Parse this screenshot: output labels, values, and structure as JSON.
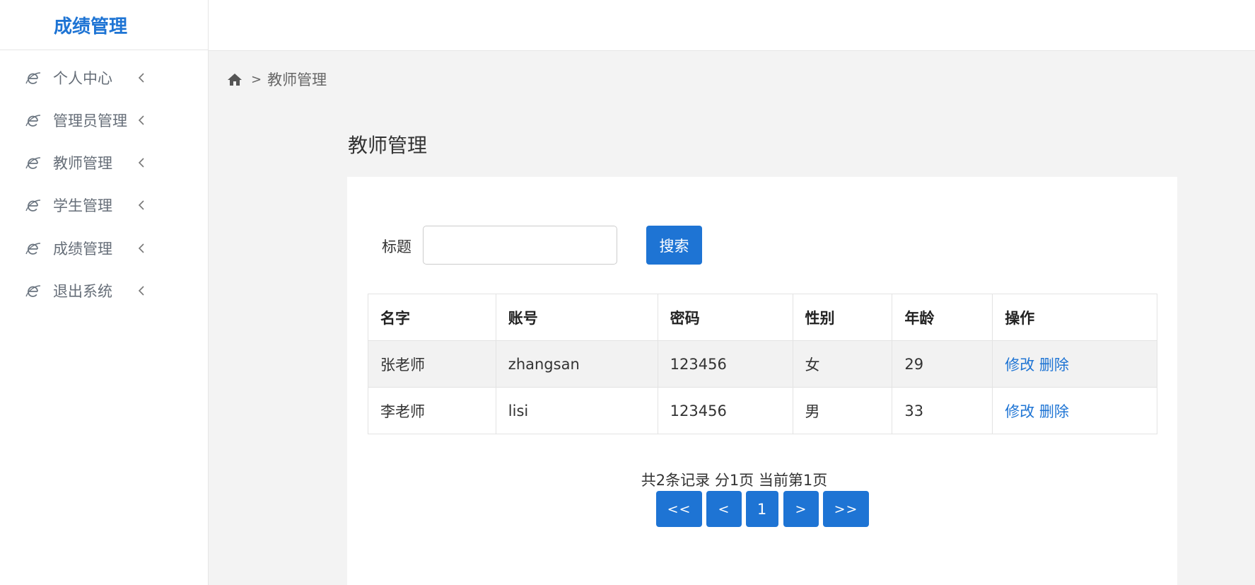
{
  "sidebar": {
    "brand": "成绩管理",
    "items": [
      {
        "label": "个人中心"
      },
      {
        "label": "管理员管理"
      },
      {
        "label": "教师管理"
      },
      {
        "label": "学生管理"
      },
      {
        "label": "成绩管理"
      },
      {
        "label": "退出系统"
      }
    ]
  },
  "breadcrumb": {
    "separator": ">",
    "current": "教师管理"
  },
  "main": {
    "title": "教师管理",
    "search": {
      "label": "标题",
      "value": "",
      "placeholder": "",
      "button": "搜索"
    },
    "table": {
      "headers": [
        "名字",
        "账号",
        "密码",
        "性别",
        "年龄",
        "操作"
      ],
      "rows": [
        {
          "name": "张老师",
          "account": "zhangsan",
          "password": "123456",
          "gender": "女",
          "age": "29",
          "edit": "修改",
          "delete": "删除"
        },
        {
          "name": "李老师",
          "account": "lisi",
          "password": "123456",
          "gender": "男",
          "age": "33",
          "edit": "修改",
          "delete": "删除"
        }
      ]
    },
    "pagination": {
      "info": "共2条记录 分1页 当前第1页",
      "first": "<<",
      "prev": "<",
      "current": "1",
      "next": ">",
      "last": ">>"
    }
  },
  "colors": {
    "accent": "#1e74d4",
    "background": "#f3f3f3",
    "nav_text": "#666e78"
  }
}
